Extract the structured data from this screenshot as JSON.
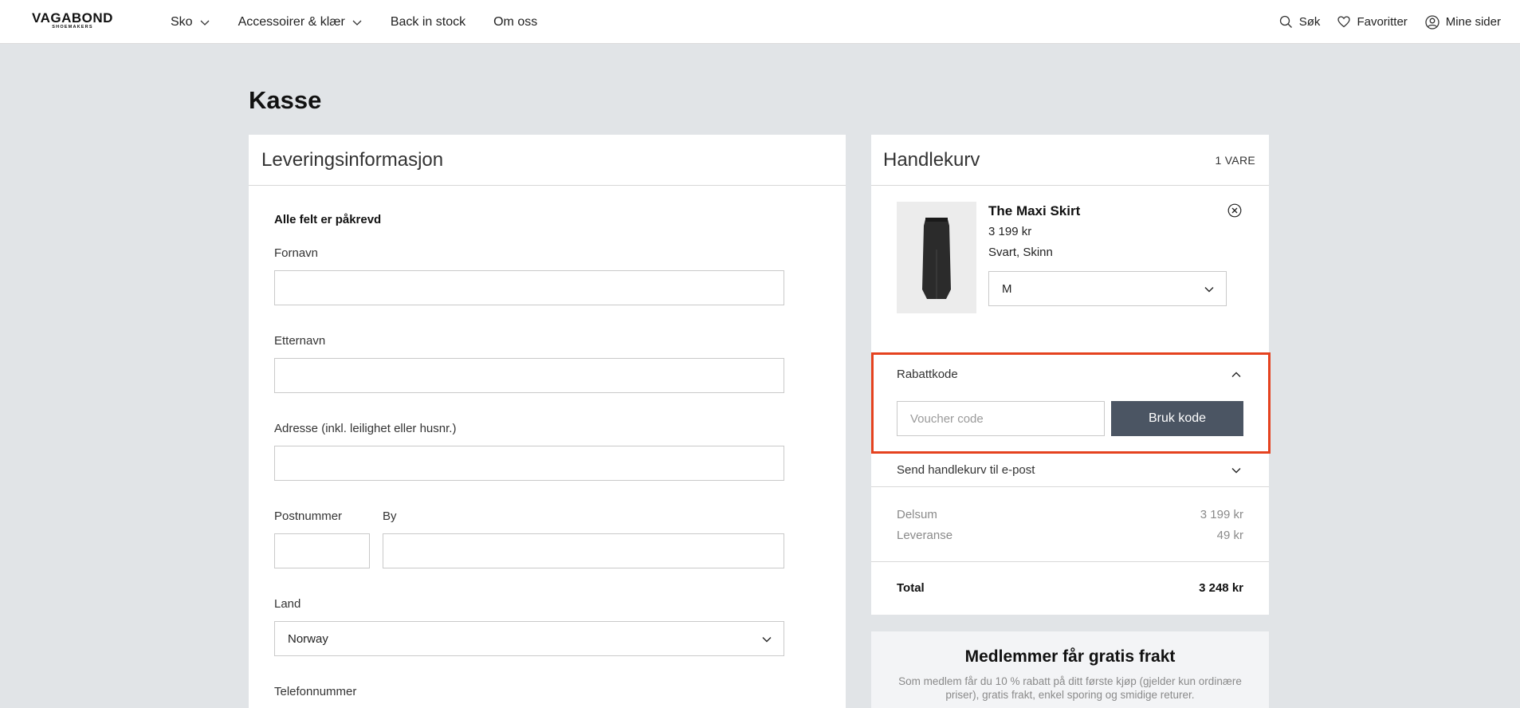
{
  "header": {
    "logo": "VAGABOND",
    "logo_sub": "SHOEMAKERS",
    "nav": [
      {
        "label": "Sko",
        "has_dropdown": true
      },
      {
        "label": "Accessoirer & klær",
        "has_dropdown": true
      },
      {
        "label": "Back in stock",
        "has_dropdown": false
      },
      {
        "label": "Om oss",
        "has_dropdown": false
      }
    ],
    "search": "Søk",
    "favorites": "Favoritter",
    "account": "Mine sider"
  },
  "page_title": "Kasse",
  "delivery": {
    "title": "Leveringsinformasjon",
    "required_note": "Alle felt er påkrevd",
    "fields": {
      "first_name": "Fornavn",
      "last_name": "Etternavn",
      "address": "Adresse (inkl. leilighet eller husnr.)",
      "postal_code": "Postnummer",
      "city": "By",
      "country": "Land",
      "country_value": "Norway",
      "phone": "Telefonnummer"
    }
  },
  "cart": {
    "title": "Handlekurv",
    "count": "1 VARE",
    "item": {
      "name": "The Maxi Skirt",
      "price": "3 199 kr",
      "variant": "Svart, Skinn",
      "size": "M"
    },
    "discount": {
      "label": "Rabattkode",
      "placeholder": "Voucher code",
      "button": "Bruk kode"
    },
    "email_cart": "Send handlekurv til e-post",
    "subtotal_label": "Delsum",
    "subtotal_value": "3 199 kr",
    "shipping_label": "Leveranse",
    "shipping_value": "49 kr",
    "total_label": "Total",
    "total_value": "3 248 kr"
  },
  "promo": {
    "title": "Medlemmer får gratis frakt",
    "text": "Som medlem får du 10 % rabatt på ditt første kjøp (gjelder kun ordinære priser), gratis frakt, enkel sporing og smidige returer."
  },
  "colors": {
    "page_bg": "#e1e4e7",
    "button_bg": "#4b5563",
    "highlight": "#e5421f"
  }
}
